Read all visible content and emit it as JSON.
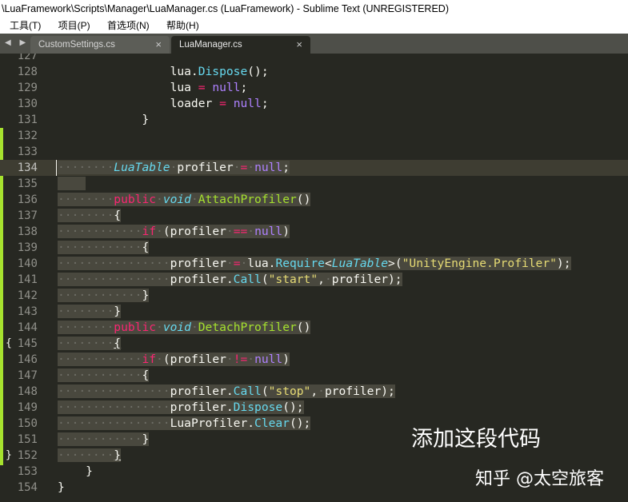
{
  "window": {
    "title": "\\LuaFramework\\Scripts\\Manager\\LuaManager.cs (LuaFramework) - Sublime Text (UNREGISTERED)"
  },
  "menu": [
    "工具(T)",
    "项目(P)",
    "首选项(N)",
    "帮助(H)"
  ],
  "tabs": [
    {
      "label": "CustomSettings.cs",
      "close": "×",
      "active": false
    },
    {
      "label": "LuaManager.cs",
      "close": "×",
      "active": true
    }
  ],
  "tab_nav": "◀ ▶",
  "lines": [
    {
      "n": "127",
      "html": "<span class=\"call\"></span>"
    },
    {
      "n": "128",
      "html": "                lua.<span class=\"call\">Dispose</span>();"
    },
    {
      "n": "129",
      "html": "                lua <span class=\"op\">=</span> <span class=\"cn\">null</span>;"
    },
    {
      "n": "130",
      "html": "                loader <span class=\"op\">=</span> <span class=\"cn\">null</span>;"
    },
    {
      "n": "131",
      "html": "            }"
    },
    {
      "n": "132",
      "html": ""
    },
    {
      "n": "133",
      "html": ""
    },
    {
      "n": "134",
      "html": "<span class=\"sel\"><span class=\"ws\">········</span><span class=\"ty\">LuaTable</span><span class=\"ws\">·</span>profiler<span class=\"ws\">·</span><span class=\"op\">=</span><span class=\"ws\">·</span><span class=\"cn\">null</span>;</span>"
    },
    {
      "n": "135",
      "html": "<span class=\"sel\">    </span>"
    },
    {
      "n": "136",
      "html": "<span class=\"sel\"><span class=\"ws\">········</span><span class=\"kw\">public</span><span class=\"ws\">·</span><span class=\"st\">void</span><span class=\"ws\">·</span><span class=\"fn\">AttachProfiler</span>()</span>"
    },
    {
      "n": "137",
      "html": "<span class=\"sel\"><span class=\"ws\">········</span>{</span>"
    },
    {
      "n": "138",
      "html": "<span class=\"sel\"><span class=\"ws\">············</span><span class=\"kw\">if</span><span class=\"ws\">·</span>(profiler<span class=\"ws\">·</span><span class=\"op\">==</span><span class=\"ws\">·</span><span class=\"cn\">null</span>)</span>"
    },
    {
      "n": "139",
      "html": "<span class=\"sel\"><span class=\"ws\">············</span>{</span>"
    },
    {
      "n": "140",
      "html": "<span class=\"sel\"><span class=\"ws\">················</span>profiler<span class=\"ws\">·</span><span class=\"op\">=</span><span class=\"ws\">·</span>lua.<span class=\"call\">Require</span>&lt;<span class=\"ty\">LuaTable</span>&gt;(<span class=\"str\">\"UnityEngine.Profiler\"</span>);</span>"
    },
    {
      "n": "141",
      "html": "<span class=\"sel\"><span class=\"ws\">················</span>profiler.<span class=\"call\">Call</span>(<span class=\"str\">\"start\"</span>,<span class=\"ws\">·</span>profiler);</span>"
    },
    {
      "n": "142",
      "html": "<span class=\"sel\"><span class=\"ws\">············</span>}</span>"
    },
    {
      "n": "143",
      "html": "<span class=\"sel\"><span class=\"ws\">········</span>}</span>"
    },
    {
      "n": "144",
      "html": "<span class=\"sel\"><span class=\"ws\">········</span><span class=\"kw\">public</span><span class=\"ws\">·</span><span class=\"st\">void</span><span class=\"ws\">·</span><span class=\"fn\">DetachProfiler</span>()</span>"
    },
    {
      "n": "145",
      "html": "<span class=\"sel\"><span class=\"ws\">········</span><u>{</u></span>",
      "fold": "{"
    },
    {
      "n": "146",
      "html": "<span class=\"sel\"><span class=\"ws\">············</span><span class=\"kw\">if</span><span class=\"ws\">·</span>(profiler<span class=\"ws\">·</span><span class=\"op\">!=</span><span class=\"ws\">·</span><span class=\"cn\">null</span>)</span>"
    },
    {
      "n": "147",
      "html": "<span class=\"sel\"><span class=\"ws\">············</span>{</span>"
    },
    {
      "n": "148",
      "html": "<span class=\"sel\"><span class=\"ws\">················</span>profiler.<span class=\"call\">Call</span>(<span class=\"str\">\"stop\"</span>,<span class=\"ws\">·</span>profiler);</span>"
    },
    {
      "n": "149",
      "html": "<span class=\"sel\"><span class=\"ws\">················</span>profiler.<span class=\"call\">Dispose</span>();</span>"
    },
    {
      "n": "150",
      "html": "<span class=\"sel\"><span class=\"ws\">················</span>LuaProfiler.<span class=\"call\">Clear</span>();</span>"
    },
    {
      "n": "151",
      "html": "<span class=\"sel\"><span class=\"ws\">············</span>}</span>"
    },
    {
      "n": "152",
      "html": "<span class=\"sel\"><span class=\"ws\">········</span><u>}</u></span>",
      "fold": "}"
    },
    {
      "n": "153",
      "html": "    }"
    },
    {
      "n": "154",
      "html": "}"
    }
  ],
  "current_line": "134",
  "annotation": "添加这段代码",
  "watermark": "知乎 @太空旅客",
  "colors": {
    "background": "#272822",
    "keyword": "#f92672",
    "type": "#66d9ef",
    "function": "#a6e22e",
    "constant": "#ae81ff",
    "string": "#e6db74",
    "selection": "#49483e"
  }
}
